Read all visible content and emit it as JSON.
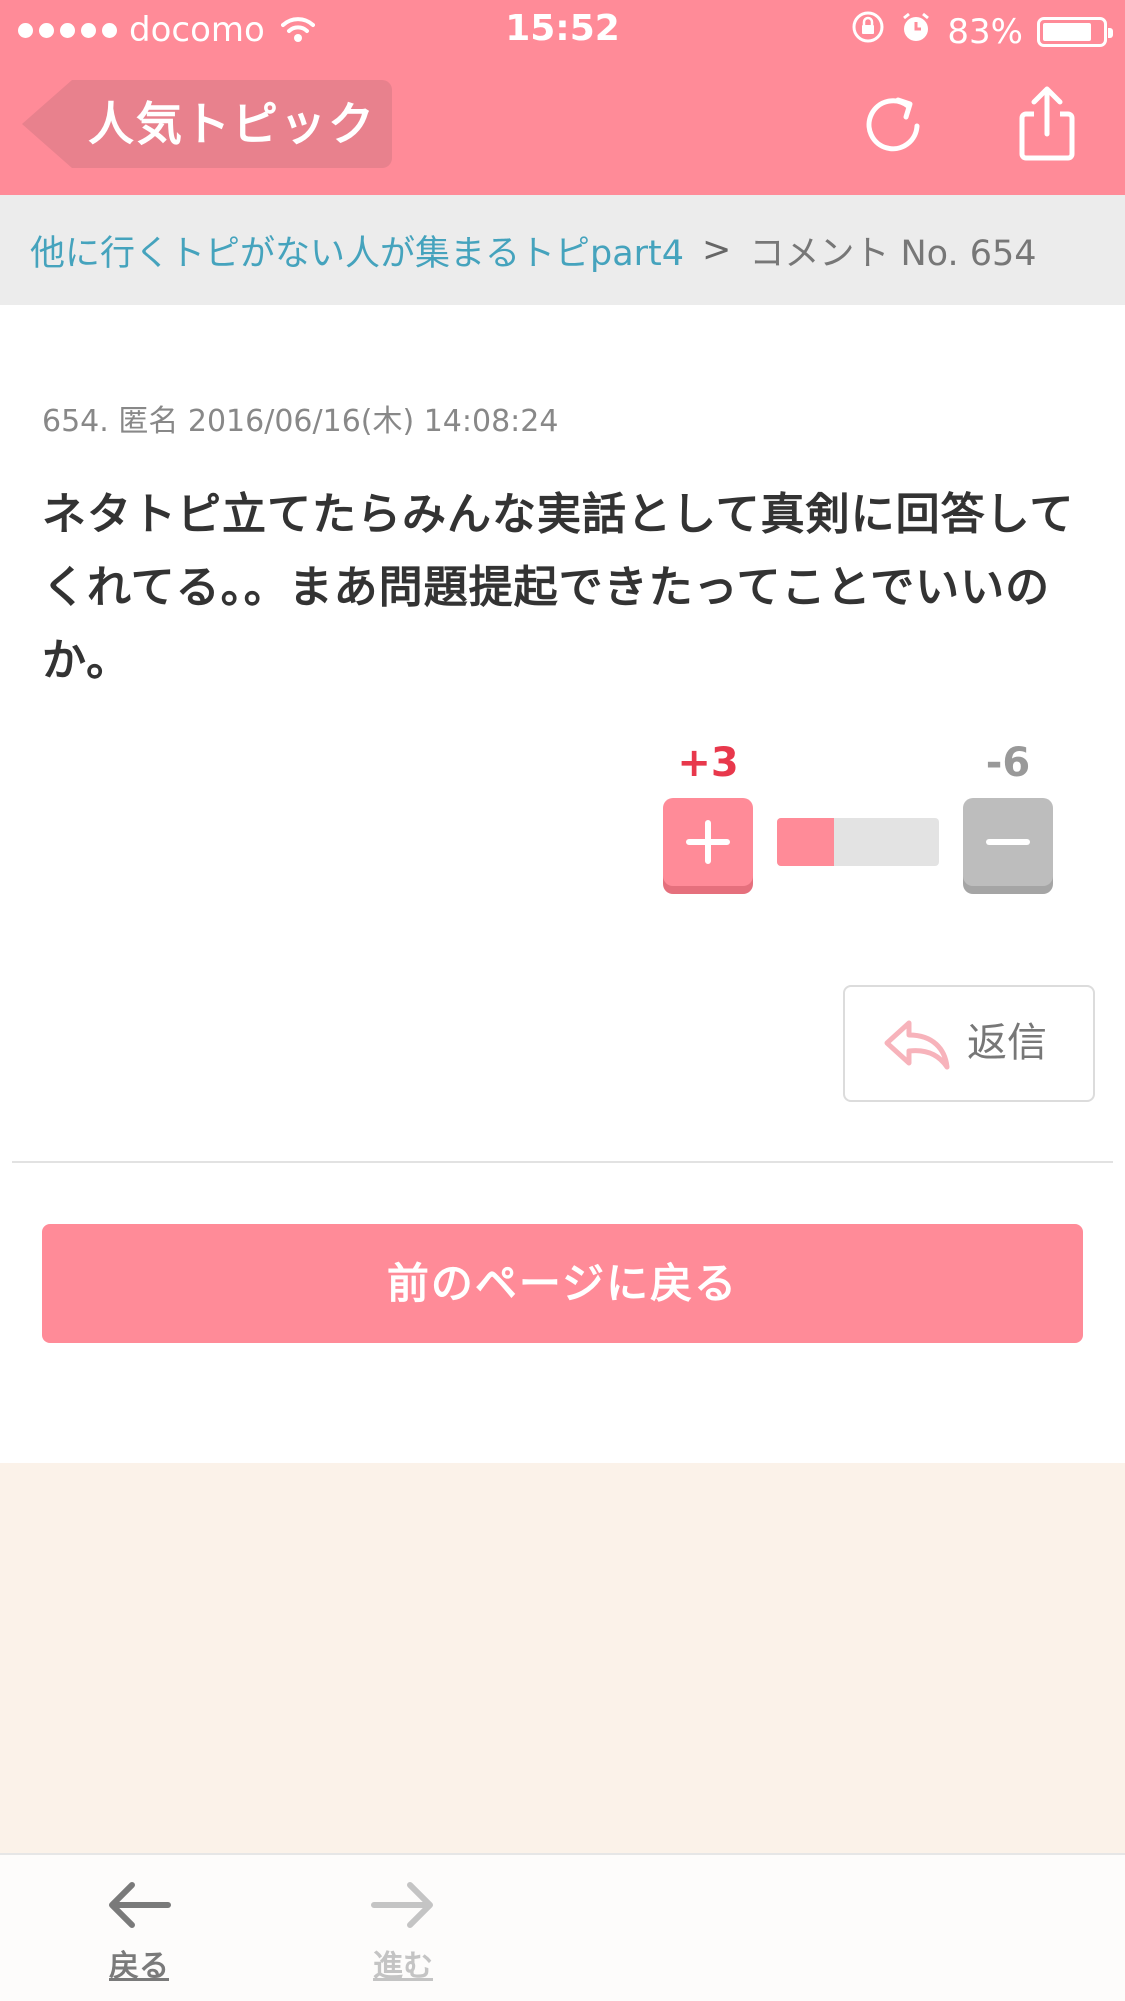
{
  "status_bar": {
    "carrier": "docomo",
    "time": "15:52",
    "battery": "83%",
    "battery_level": 0.83
  },
  "header": {
    "back_label": "人気トピック",
    "icons": [
      "refresh-icon",
      "share-icon"
    ]
  },
  "breadcrumb": {
    "topic_link": "他に行くトピがない人が集まるトピpart4",
    "separator": ">",
    "current": "コメント No. 654"
  },
  "comment": {
    "meta": "654. 匿名 2016/06/16(木) 14:08:24",
    "body": "ネタトピ立てたらみんな実話として真剣に回答してくれてる。。まあ問題提起できたってことでいいのか。",
    "plus_count": "+3",
    "minus_count": "-6",
    "vote_ratio": 0.35,
    "reply_label": "返信"
  },
  "prev_page_label": "前のページに戻る",
  "toolbar": {
    "back_label": "戻る",
    "forward_label": "進む"
  },
  "colors": {
    "accent": "#ff8b98",
    "link": "#45a3bd",
    "plus": "#e8384c",
    "beige": "#fbf2e9"
  }
}
